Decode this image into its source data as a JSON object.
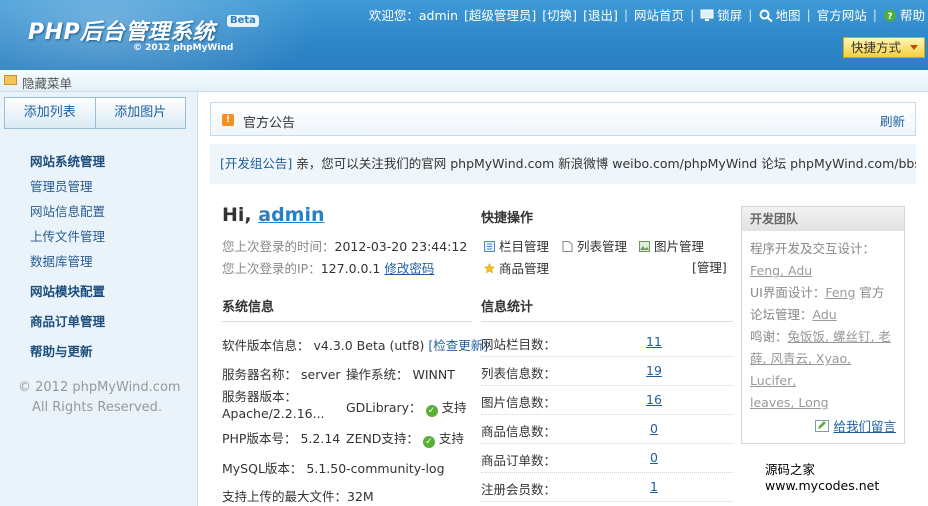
{
  "header": {
    "logo_title": "PHP后台管理系统",
    "logo_beta": "Beta",
    "logo_copy": "© 2012 phpMyWind",
    "welcome": "欢迎您：admin",
    "role": "[超级管理员]",
    "switch": "[切换]",
    "logout": "[退出]",
    "site_home": "网站首页",
    "lock": "锁屏",
    "map": "地图",
    "official": "官方网站",
    "help": "帮助",
    "quick_button": "快捷方式"
  },
  "subbar": {
    "toggle_menu": "隐藏菜单"
  },
  "sidebar": {
    "tabs": [
      "添加列表",
      "添加图片"
    ],
    "group_site": "网站系统管理",
    "items_site": [
      "管理员管理",
      "网站信息配置",
      "上传文件管理",
      "数据库管理"
    ],
    "group_module": "网站模块配置",
    "group_orders": "商品订单管理",
    "group_help": "帮助与更新",
    "copyright_line1": "© 2012 phpMyWind.com",
    "copyright_line2": "All Rights Reserved."
  },
  "notice": {
    "title": "官方公告",
    "refresh": "刷新",
    "tag": "[开发组公告]",
    "text": " 亲，您可以关注我们的官网 phpMyWind.com 新浪微博 weibo.com/phpMyWind 论坛 phpMyWind.com/bbs来"
  },
  "greeting": {
    "hi": "Hi, ",
    "user": "admin",
    "last_time_label": "您上次登录的时间：",
    "last_time": "2012-03-20 23:44:12",
    "last_ip_label": "您上次登录的IP：",
    "last_ip": "127.0.0.1",
    "change_password": "修改密码"
  },
  "quick_ops": {
    "title": "快捷操作",
    "items": [
      "栏目管理",
      "列表管理",
      "图片管理",
      "商品管理"
    ],
    "manage": "[管理]"
  },
  "system_info": {
    "title": "系统信息",
    "version_label": "软件版本信息：",
    "version": "v4.3.0 Beta (utf8)",
    "check_update": "[检查更新]",
    "server_name_label": "服务器名称：",
    "server_name": "server",
    "os_label": "操作系统：",
    "os": "WINNT",
    "server_ver_label": "服务器版本：",
    "server_ver": "Apache/2.2.16...",
    "gd_label": "GDLibrary：",
    "gd": "支持",
    "php_label": "PHP版本号：",
    "php": "5.2.14",
    "zend_label": "ZEND支持：",
    "zend": "支持",
    "mysql_label": "MySQL版本：",
    "mysql": "5.1.50-community-log",
    "upload_label": "支持上传的最大文件：",
    "upload": "32M"
  },
  "stats": {
    "title": "信息统计",
    "rows": [
      {
        "label": "网站栏目数：",
        "value": "11"
      },
      {
        "label": "列表信息数：",
        "value": "19"
      },
      {
        "label": "图片信息数：",
        "value": "16"
      },
      {
        "label": "商品信息数：",
        "value": "0"
      },
      {
        "label": "商品订单数：",
        "value": "0"
      },
      {
        "label": "注册会员数：",
        "value": "1"
      }
    ]
  },
  "dev_team": {
    "title": "开发团队",
    "line1": "程序开发及交互设计：",
    "line1_names": "Feng, Adu",
    "line2_label": "UI界面设计：",
    "line2_name": "Feng",
    "line2_tail": " 官方",
    "line3_label": "论坛管理：",
    "line3_name": "Adu",
    "line4": "鸣谢：",
    "line4_names_a": "兔饭饭, 螺丝钉, 老",
    "line4_names_b": "薛, 风青云, Xyao, Lucifer,",
    "line4_names_c": "leaves, Long",
    "message": "给我们留言"
  },
  "watermark": "源码之家www.mycodes.net",
  "colors": {
    "header_blue": "#2f88c9",
    "link": "#1d5f9e",
    "button_yellow": "#f4cf3c",
    "ok_green": "#5ab035",
    "notice_orange": "#f28f1f"
  }
}
